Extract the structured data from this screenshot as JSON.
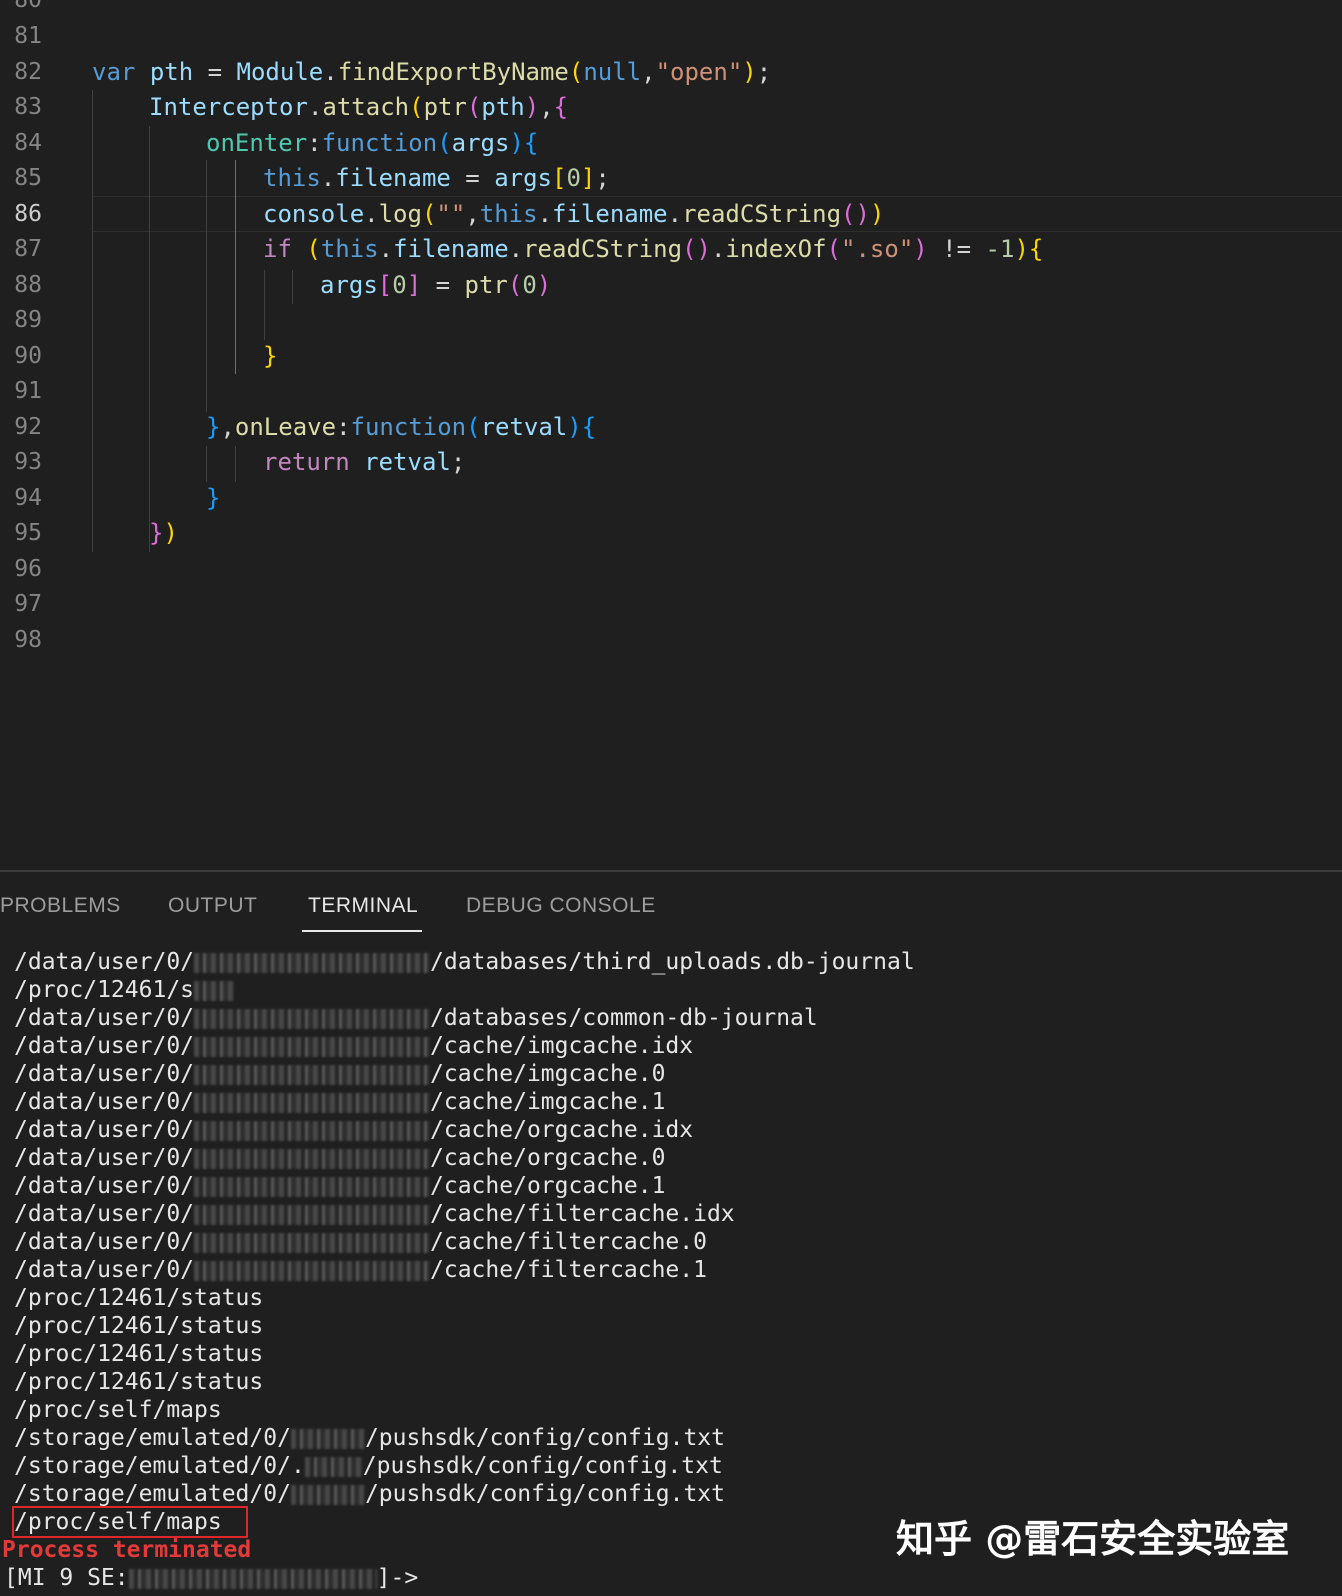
{
  "editor": {
    "partial_top_line_number": "80",
    "lines": [
      {
        "num": "81",
        "tokens": []
      },
      {
        "num": "82",
        "tokens": [
          [
            "k",
            "var"
          ],
          [
            "p",
            " "
          ],
          [
            "v",
            "pth"
          ],
          [
            "p",
            " = "
          ],
          [
            "v",
            "Module"
          ],
          [
            "p",
            "."
          ],
          [
            "f",
            "findExportByName"
          ],
          [
            "b1",
            "("
          ],
          [
            "k",
            "null"
          ],
          [
            "p",
            ","
          ],
          [
            "s",
            "\"open\""
          ],
          [
            "b1",
            ")"
          ],
          [
            "p",
            ";"
          ]
        ]
      },
      {
        "num": "83",
        "tokens": [
          [
            "v",
            "Interceptor"
          ],
          [
            "p",
            "."
          ],
          [
            "f",
            "attach"
          ],
          [
            "b1",
            "("
          ],
          [
            "f",
            "ptr"
          ],
          [
            "b2",
            "("
          ],
          [
            "v",
            "pth"
          ],
          [
            "b2",
            ")"
          ],
          [
            "p",
            ","
          ],
          [
            "b2",
            "{"
          ]
        ]
      },
      {
        "num": "84",
        "tokens": [
          [
            "t",
            "onEnter"
          ],
          [
            "p",
            ":"
          ],
          [
            "k",
            "function"
          ],
          [
            "b3",
            "("
          ],
          [
            "v",
            "args"
          ],
          [
            "b3",
            ")"
          ],
          [
            "b3",
            "{"
          ]
        ]
      },
      {
        "num": "85",
        "tokens": [
          [
            "k",
            "this"
          ],
          [
            "p",
            "."
          ],
          [
            "v",
            "filename"
          ],
          [
            "p",
            " = "
          ],
          [
            "v",
            "args"
          ],
          [
            "b1",
            "["
          ],
          [
            "n",
            "0"
          ],
          [
            "b1",
            "]"
          ],
          [
            "p",
            ";"
          ]
        ]
      },
      {
        "num": "86",
        "tokens": [
          [
            "v",
            "console"
          ],
          [
            "p",
            "."
          ],
          [
            "f",
            "log"
          ],
          [
            "b1",
            "("
          ],
          [
            "s",
            "\"\""
          ],
          [
            "p",
            ","
          ],
          [
            "k",
            "this"
          ],
          [
            "p",
            "."
          ],
          [
            "v",
            "filename"
          ],
          [
            "p",
            "."
          ],
          [
            "f",
            "readCString"
          ],
          [
            "b2",
            "("
          ],
          [
            "b2",
            ")"
          ],
          [
            "b1",
            ")"
          ]
        ]
      },
      {
        "num": "87",
        "tokens": [
          [
            "c",
            "if"
          ],
          [
            "p",
            " "
          ],
          [
            "b1",
            "("
          ],
          [
            "k",
            "this"
          ],
          [
            "p",
            "."
          ],
          [
            "v",
            "filename"
          ],
          [
            "p",
            "."
          ],
          [
            "f",
            "readCString"
          ],
          [
            "b2",
            "("
          ],
          [
            "b2",
            ")"
          ],
          [
            "p",
            "."
          ],
          [
            "f",
            "indexOf"
          ],
          [
            "b2",
            "("
          ],
          [
            "s",
            "\".so\""
          ],
          [
            "b2",
            ")"
          ],
          [
            "p",
            " != "
          ],
          [
            "n",
            "-1"
          ],
          [
            "b1",
            ")"
          ],
          [
            "b1",
            "{"
          ]
        ]
      },
      {
        "num": "88",
        "tokens": [
          [
            "v",
            "args"
          ],
          [
            "b2",
            "["
          ],
          [
            "n",
            "0"
          ],
          [
            "b2",
            "]"
          ],
          [
            "p",
            " = "
          ],
          [
            "f",
            "ptr"
          ],
          [
            "b2",
            "("
          ],
          [
            "n",
            "0"
          ],
          [
            "b2",
            ")"
          ]
        ]
      },
      {
        "num": "89",
        "tokens": []
      },
      {
        "num": "90",
        "tokens": [
          [
            "b1",
            "}"
          ]
        ]
      },
      {
        "num": "91",
        "tokens": []
      },
      {
        "num": "92",
        "tokens": [
          [
            "b3",
            "}"
          ],
          [
            "p",
            ","
          ],
          [
            "f",
            "onLeave"
          ],
          [
            "p",
            ":"
          ],
          [
            "k",
            "function"
          ],
          [
            "b3",
            "("
          ],
          [
            "v",
            "retval"
          ],
          [
            "b3",
            ")"
          ],
          [
            "b3",
            "{"
          ]
        ]
      },
      {
        "num": "93",
        "tokens": [
          [
            "c",
            "return"
          ],
          [
            "p",
            " "
          ],
          [
            "v",
            "retval"
          ],
          [
            "p",
            ";"
          ]
        ]
      },
      {
        "num": "94",
        "tokens": [
          [
            "b3",
            "}"
          ]
        ]
      },
      {
        "num": "95",
        "tokens": [
          [
            "b2",
            "}"
          ],
          [
            "b1",
            ")"
          ]
        ]
      },
      {
        "num": "96",
        "tokens": []
      },
      {
        "num": "97",
        "tokens": []
      },
      {
        "num": "98",
        "tokens": []
      }
    ],
    "active_line": "86"
  },
  "panel": {
    "tabs": [
      {
        "label": "PROBLEMS",
        "active": false
      },
      {
        "label": "OUTPUT",
        "active": false
      },
      {
        "label": "TERMINAL",
        "active": true
      },
      {
        "label": "DEBUG CONSOLE",
        "active": false
      }
    ],
    "terminal_lines": [
      {
        "prefix": "/data/user/0/",
        "redacted": true,
        "suffix": "/databases/third_uploads.db-journal"
      },
      {
        "prefix": "/proc/12461/s",
        "redacted": true,
        "suffix": ""
      },
      {
        "prefix": "/data/user/0/",
        "redacted": true,
        "suffix": "/databases/common-db-journal"
      },
      {
        "prefix": "/data/user/0/",
        "redacted": true,
        "suffix": "/cache/imgcache.idx"
      },
      {
        "prefix": "/data/user/0/",
        "redacted": true,
        "suffix": "/cache/imgcache.0"
      },
      {
        "prefix": "/data/user/0/",
        "redacted": true,
        "suffix": "/cache/imgcache.1"
      },
      {
        "prefix": "/data/user/0/",
        "redacted": true,
        "suffix": "/cache/orgcache.idx"
      },
      {
        "prefix": "/data/user/0/",
        "redacted": true,
        "suffix": "/cache/orgcache.0"
      },
      {
        "prefix": "/data/user/0/",
        "redacted": true,
        "suffix": "/cache/orgcache.1"
      },
      {
        "prefix": "/data/user/0/",
        "redacted": true,
        "suffix": "/cache/filtercache.idx"
      },
      {
        "prefix": "/data/user/0/",
        "redacted": true,
        "suffix": "/cache/filtercache.0"
      },
      {
        "prefix": "/data/user/0/",
        "redacted": true,
        "suffix": "/cache/filtercache.1"
      },
      {
        "prefix": "/proc/12461/status",
        "redacted": false,
        "suffix": ""
      },
      {
        "prefix": "/proc/12461/status",
        "redacted": false,
        "suffix": ""
      },
      {
        "prefix": "/proc/12461/status",
        "redacted": false,
        "suffix": ""
      },
      {
        "prefix": "/proc/12461/status",
        "redacted": false,
        "suffix": ""
      },
      {
        "prefix": "/proc/self/maps",
        "redacted": false,
        "suffix": ""
      },
      {
        "prefix": "/storage/emulated/0/",
        "redacted": true,
        "suffix": "/pushsdk/config/config.txt"
      },
      {
        "prefix": "/storage/emulated/0/.",
        "redacted": true,
        "suffix": "/pushsdk/config/config.txt"
      },
      {
        "prefix": "/storage/emulated/0/",
        "redacted": true,
        "suffix": "/pushsdk/config/config.txt"
      },
      {
        "prefix": "/proc/self/maps",
        "redacted": false,
        "suffix": ""
      }
    ],
    "process_terminated": "Process terminated",
    "prompt_prefix": "[MI 9 SE:",
    "prompt_suffix": "]->",
    "watermark": "知乎 @雷石安全实验室",
    "accent_color": "#e0262a"
  }
}
